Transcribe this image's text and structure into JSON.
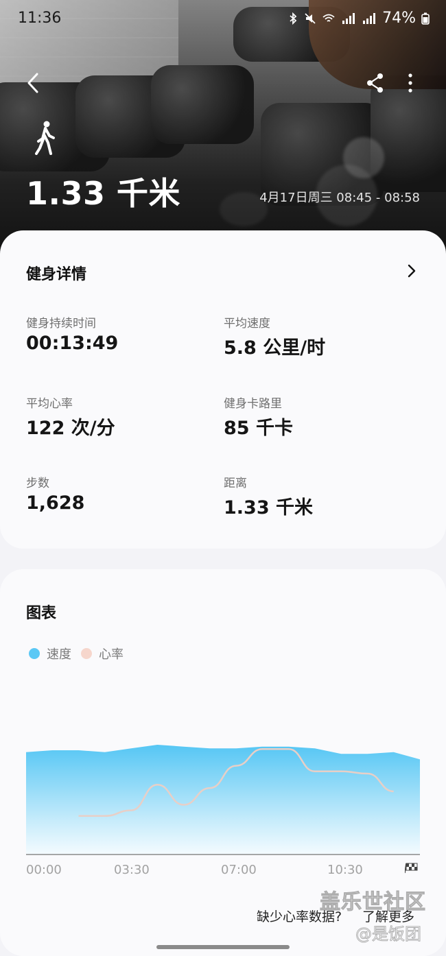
{
  "status_bar": {
    "time": "11:36",
    "battery": "74%"
  },
  "header": {
    "activity_icon": "walking-icon",
    "distance": "1.33 千米",
    "datetime": "4月17日周三 08:45 - 08:58"
  },
  "details": {
    "title": "健身详情",
    "metrics": [
      {
        "label": "健身持续时间",
        "value": "00:13:49"
      },
      {
        "label": "平均速度",
        "value": "5.8 公里/时"
      },
      {
        "label": "平均心率",
        "value": "122 次/分"
      },
      {
        "label": "健身卡路里",
        "value": "85 千卡"
      },
      {
        "label": "步数",
        "value": "1,628"
      },
      {
        "label": "距离",
        "value": "1.33 千米"
      }
    ]
  },
  "chart_section": {
    "title": "图表",
    "legend": [
      {
        "name": "速度",
        "color": "#5bc8f5"
      },
      {
        "name": "心率",
        "color": "#f6d6cc"
      }
    ],
    "x_ticks": [
      "00:00",
      "03:30",
      "07:00",
      "10:30"
    ],
    "missing_text": "缺少心率数据?",
    "learn_more": "了解更多"
  },
  "chart_data": {
    "type": "area",
    "x": [
      "00:00",
      "01:00",
      "02:00",
      "03:00",
      "03:30",
      "04:00",
      "05:00",
      "06:00",
      "07:00",
      "08:00",
      "09:00",
      "10:00",
      "10:30",
      "11:00",
      "12:00",
      "13:00"
    ],
    "series": [
      {
        "name": "速度",
        "values": [
          5.6,
          5.7,
          5.7,
          5.6,
          5.8,
          6.0,
          5.9,
          5.8,
          5.8,
          5.9,
          5.9,
          5.8,
          5.5,
          5.5,
          5.6,
          5.2
        ]
      },
      {
        "name": "心率",
        "values": [
          null,
          null,
          90,
          90,
          95,
          118,
          100,
          115,
          135,
          150,
          150,
          130,
          130,
          128,
          112,
          null
        ]
      }
    ],
    "xlabel": "",
    "ylabel": ""
  },
  "watermark": {
    "line1": "盖乐世社区",
    "line2": "@是饭团"
  }
}
